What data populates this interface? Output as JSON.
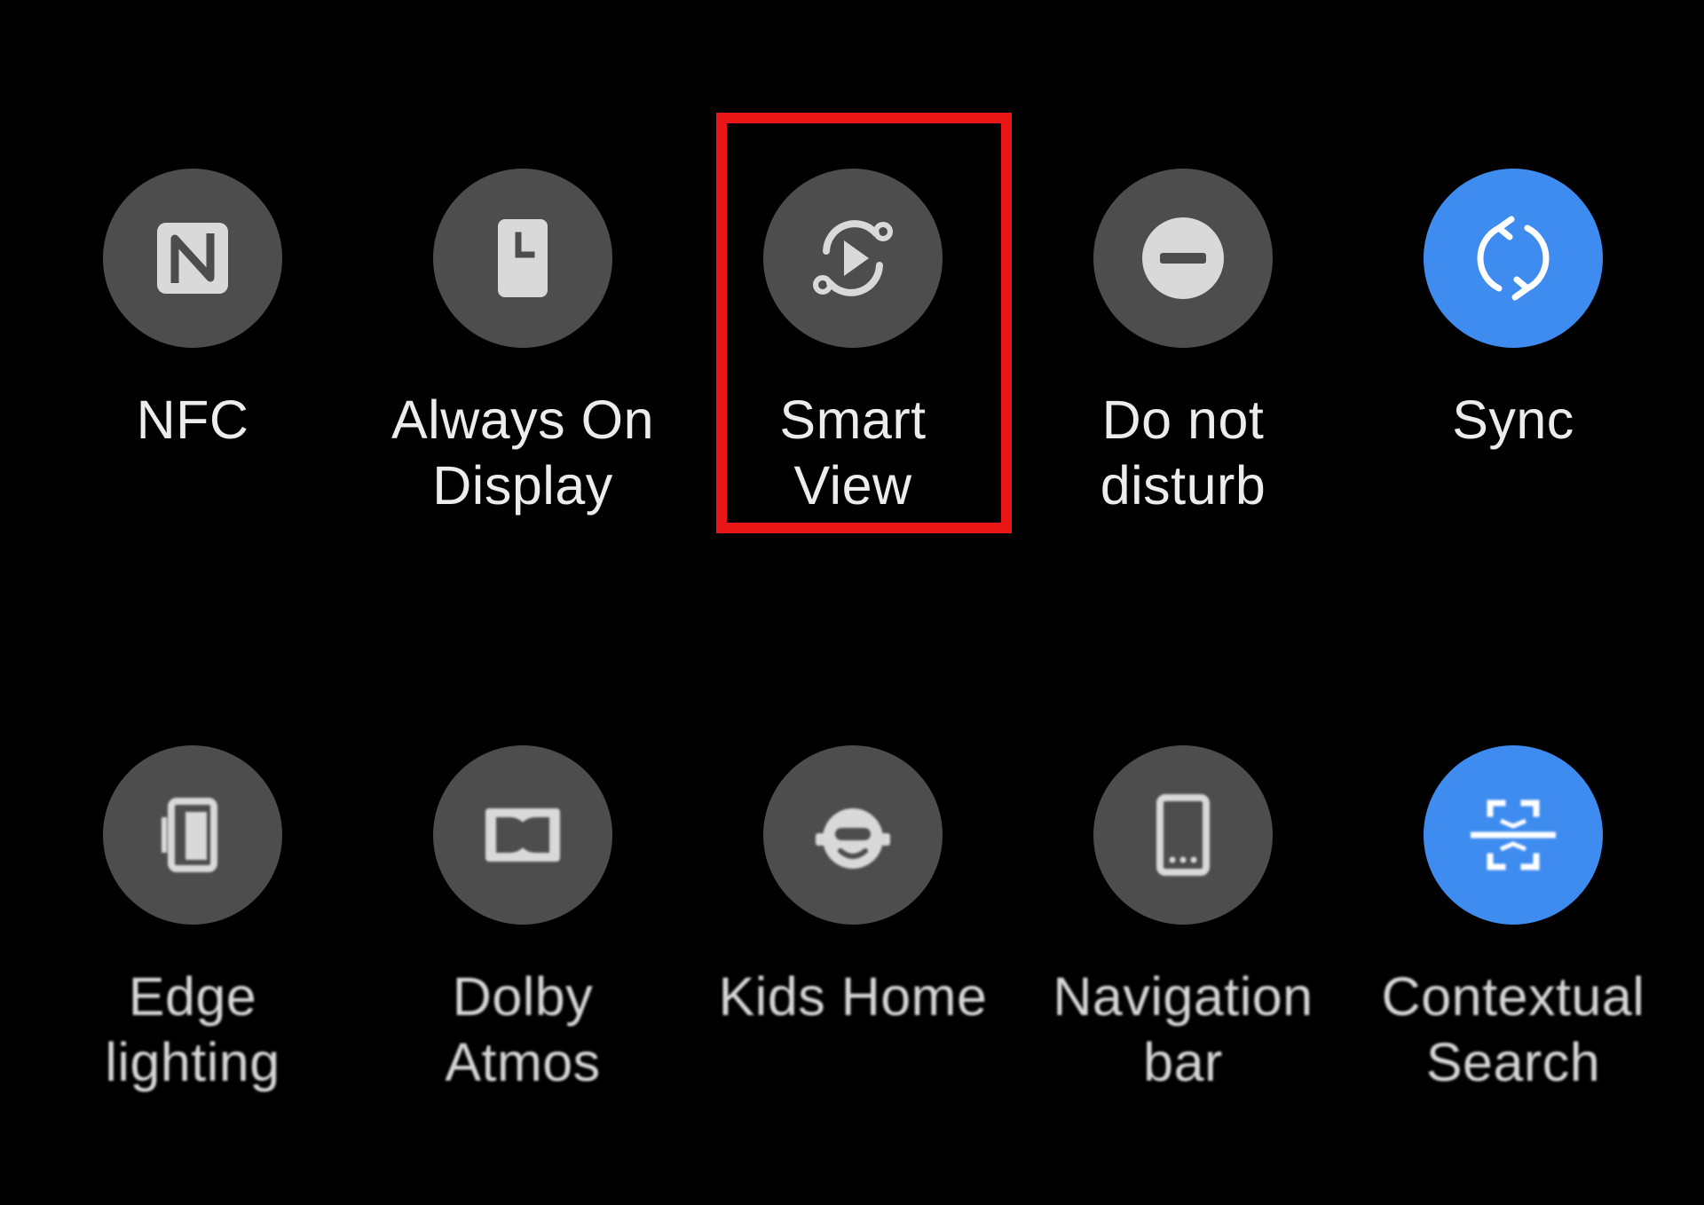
{
  "quick_panel": {
    "row1": [
      {
        "id": "nfc",
        "line1": "NFC",
        "line2": "",
        "icon": "nfc-icon",
        "state": "off"
      },
      {
        "id": "always-on-display",
        "line1": "Always On",
        "line2": "Display",
        "icon": "always-on-display-icon",
        "state": "off"
      },
      {
        "id": "smart-view",
        "line1": "Smart",
        "line2": "View",
        "icon": "smart-view-icon",
        "state": "off"
      },
      {
        "id": "do-not-disturb",
        "line1": "Do not",
        "line2": "disturb",
        "icon": "do-not-disturb-icon",
        "state": "off"
      },
      {
        "id": "sync",
        "line1": "Sync",
        "line2": "",
        "icon": "sync-icon",
        "state": "on"
      }
    ],
    "row2": [
      {
        "id": "edge-lighting",
        "line1": "Edge",
        "line2": "lighting",
        "icon": "edge-lighting-icon",
        "state": "off"
      },
      {
        "id": "dolby-atmos",
        "line1": "Dolby",
        "line2": "Atmos",
        "icon": "dolby-atmos-icon",
        "state": "off"
      },
      {
        "id": "kids-home",
        "line1": "Kids Home",
        "line2": "",
        "icon": "kids-home-icon",
        "state": "off"
      },
      {
        "id": "navigation-bar",
        "line1": "Navigation",
        "line2": "bar",
        "icon": "navigation-bar-icon",
        "state": "off"
      },
      {
        "id": "contextual-search",
        "line1": "Contextual",
        "line2": "Search",
        "icon": "contextual-search-icon",
        "state": "on"
      }
    ]
  },
  "highlighted_tile": "smart-view",
  "colors": {
    "background": "#000000",
    "tile_off": "#4d4d4d",
    "tile_on": "#3e8cf0",
    "icon_off": "#d9d9d9",
    "icon_on": "#ffffff",
    "label": "#ececec",
    "highlight_box": "#e81616"
  }
}
